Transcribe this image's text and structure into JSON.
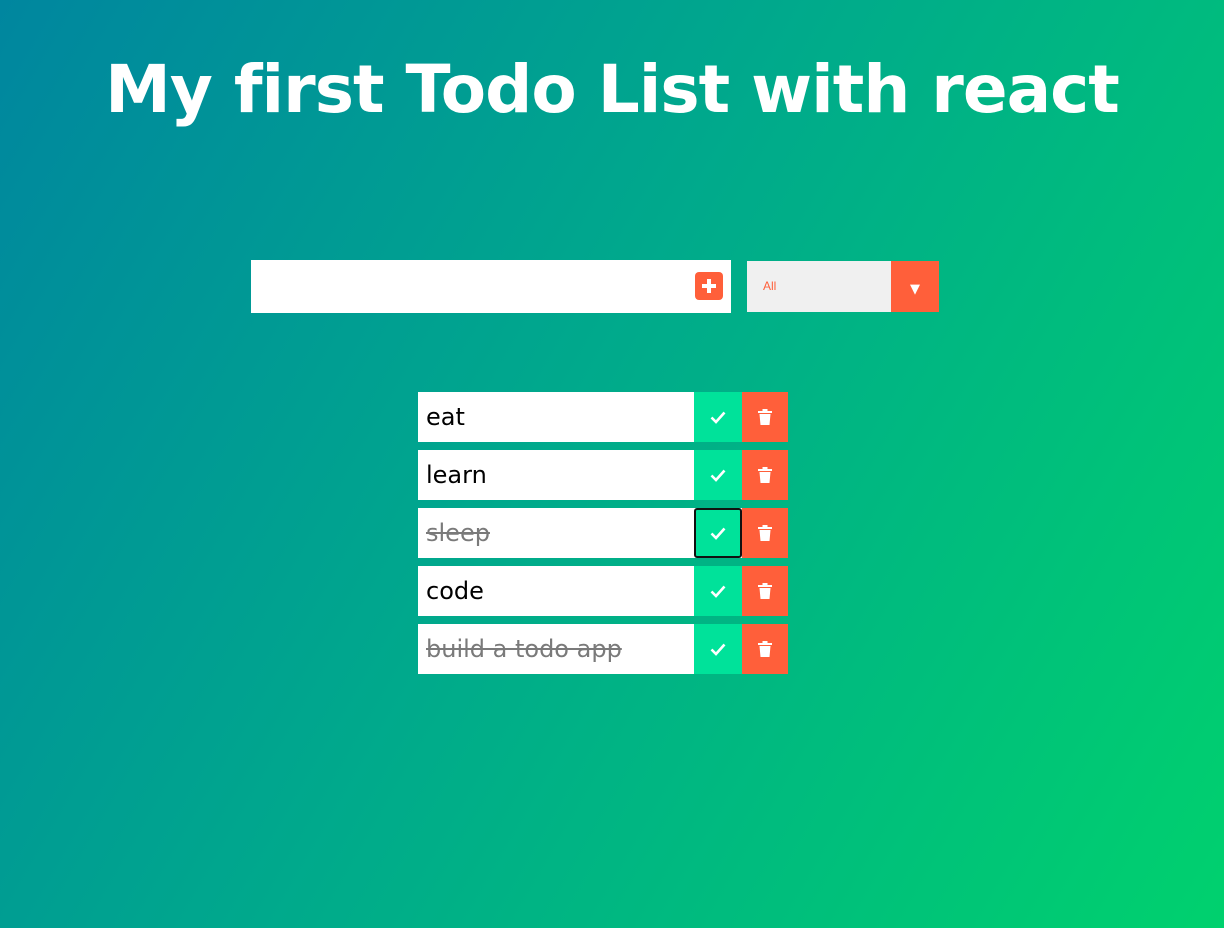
{
  "header": {
    "title": "My first Todo List with react"
  },
  "form": {
    "input_value": "",
    "add_icon": "plus-square-icon",
    "filter": {
      "selected": "All",
      "arrow_icon": "caret-down-icon"
    }
  },
  "todos": [
    {
      "text": "eat",
      "completed": false
    },
    {
      "text": "learn",
      "completed": false
    },
    {
      "text": "sleep",
      "completed": true
    },
    {
      "text": "code",
      "completed": false
    },
    {
      "text": "build a todo app",
      "completed": true
    }
  ],
  "icons": {
    "complete": "check-icon",
    "delete": "trash-icon"
  },
  "colors": {
    "accent": "#ff5f3a",
    "complete": "#00e29a",
    "gradient_start": "#00869f",
    "gradient_end": "#00d16e"
  }
}
